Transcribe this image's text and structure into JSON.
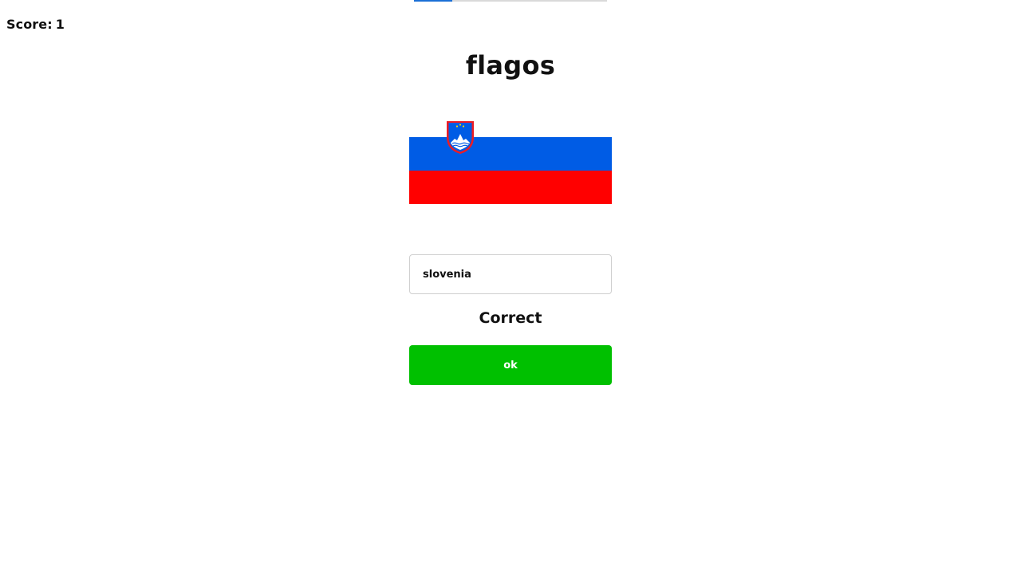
{
  "score": {
    "label": "Score:",
    "value": "1"
  },
  "progress": {
    "fraction": 0.2,
    "color": "#1a6fd6"
  },
  "title": "flagos",
  "flag": {
    "icon": "slovenia-flag-icon",
    "stripe_colors": [
      "#ffffff",
      "#005ce5",
      "#ff0000"
    ]
  },
  "answer_input": {
    "value": "slovenia",
    "placeholder": ""
  },
  "feedback": "Correct",
  "ok_button": {
    "label": "ok",
    "color": "#00c000"
  }
}
